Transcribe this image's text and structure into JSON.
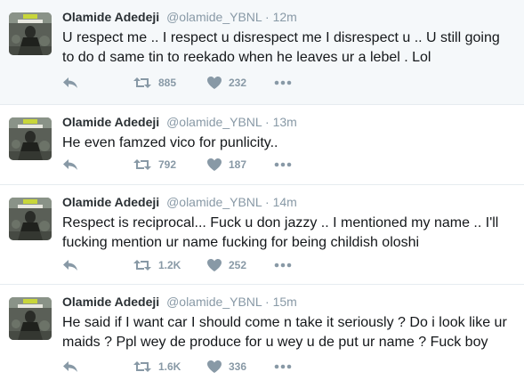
{
  "tweets": [
    {
      "name": "Olamide Adedeji",
      "handle": "@olamide_YBNL",
      "separator": "·",
      "time": "12m",
      "text": "U respect me .. I respect u disrespect me I disrespect u .. U still going to do d same tin to reekado when he leaves ur a lebel . Lol",
      "retweets": "885",
      "likes": "232"
    },
    {
      "name": "Olamide Adedeji",
      "handle": "@olamide_YBNL",
      "separator": "·",
      "time": "13m",
      "text": "He even famzed vico for punlicity..",
      "retweets": "792",
      "likes": "187"
    },
    {
      "name": "Olamide Adedeji",
      "handle": "@olamide_YBNL",
      "separator": "·",
      "time": "14m",
      "text": "Respect is reciprocal... Fuck u don jazzy .. I mentioned my name .. I'll fucking mention ur name fucking for being childish oloshi",
      "retweets": "1.2K",
      "likes": "252"
    },
    {
      "name": "Olamide Adedeji",
      "handle": "@olamide_YBNL",
      "separator": "·",
      "time": "15m",
      "text": "He said if I want car I should come n take it seriously ? Do i look like ur maids ? Ppl wey de produce for u wey u de put ur name ? Fuck boy",
      "retweets": "1.6K",
      "likes": "336"
    }
  ],
  "icons": {
    "avatar": "avatar-image",
    "reply": "reply-icon",
    "retweet": "retweet-icon",
    "like": "heart-icon",
    "more": "more-icon"
  },
  "colors": {
    "icon_gray": "#8899a6",
    "highlight_bg": "#f5f8fa",
    "divider": "#e6ecf0"
  }
}
